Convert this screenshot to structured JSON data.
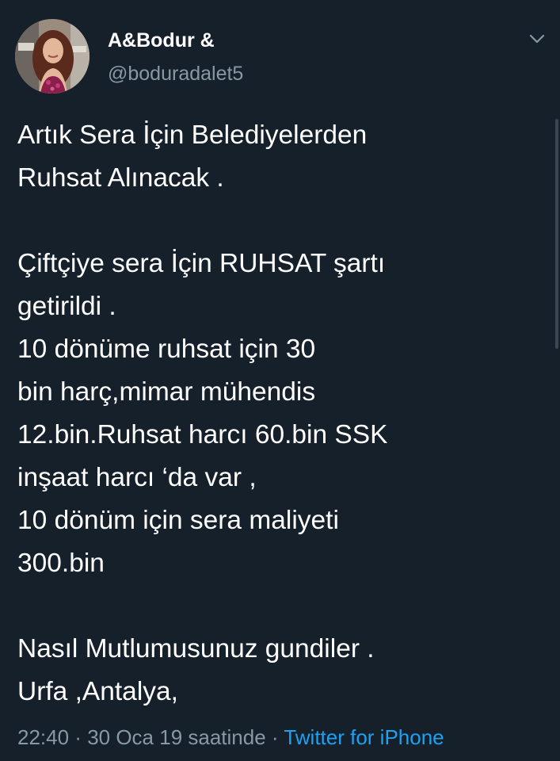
{
  "tweet": {
    "author": {
      "display_name": "A&Bodur &",
      "handle": "@boduradalet5",
      "avatar_icon": "profile-photo"
    },
    "menu_icon": "chevron-down-icon",
    "lines": {
      "l1": "Artık Sera İçin Belediyelerden",
      "l2": "Ruhsat Alınacak .",
      "l3": "Çiftçiye sera İçin RUHSAT şartı",
      "l4": "getirildi .",
      "l5": "10 dönüme ruhsat için 30",
      "l6": "bin harç,mimar mühendis",
      "l7": "12.bin.Ruhsat harcı 60.bin SSK",
      "l8": "inşaat harcı ‘da var ,",
      "l9": "10 dönüm için sera maliyeti",
      "l10": "300.bin",
      "l11": "Nasıl Mutlumusunuz gundiler .",
      "l12": "Urfa ,Antalya,"
    },
    "meta": {
      "time": "22:40",
      "separator": " · ",
      "date": "30 Oca 19 saatinde",
      "source": "Twitter for iPhone"
    }
  },
  "colors": {
    "background": "#15202b",
    "text": "#ffffff",
    "secondary": "#8899a6",
    "link": "#1da1f2"
  }
}
